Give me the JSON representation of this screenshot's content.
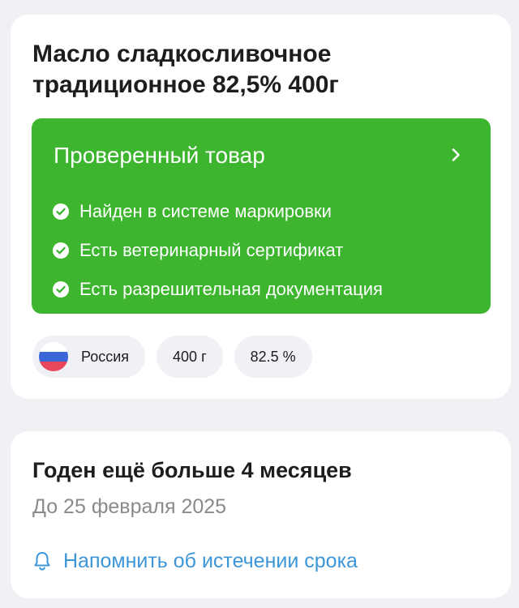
{
  "product": {
    "title": "Масло сладкосливочное традиционное 82,5% 400г"
  },
  "verification": {
    "title": "Проверенный товар",
    "chevron_icon": "chevron-right-icon",
    "check_icon": "check-circle-icon",
    "items": [
      "Найден в системе маркировки",
      "Есть ветеринарный сертификат",
      "Есть разрешительная документация"
    ]
  },
  "chips": {
    "country": "Россия",
    "country_flag_icon": "russia-flag-icon",
    "weight": "400 г",
    "fat": "82.5 %"
  },
  "expiry": {
    "title": "Годен ещё больше 4 месяцев",
    "date": "До 25 февраля 2025",
    "reminder": "Напомнить об истечении срока",
    "reminder_icon": "bell-icon"
  },
  "colors": {
    "page_background": "#f0f1f5",
    "card_background": "#ffffff",
    "verified_green": "#3db52e",
    "link_blue": "#3d96d8",
    "muted_text": "#8a8a8e",
    "chip_background": "#f0f1f5"
  }
}
